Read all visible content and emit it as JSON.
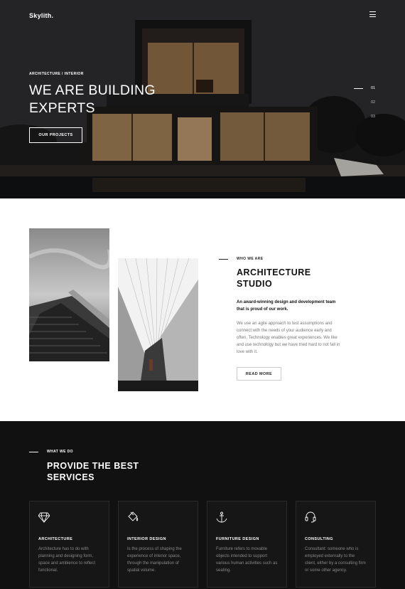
{
  "brand": {
    "logo": "Skylith."
  },
  "hero": {
    "kicker": "ARCHITECTURE / INTERIOR",
    "title": "WE ARE BUILDING EXPERTS",
    "cta": "OUR PROJECTS",
    "slides": [
      "01",
      "02",
      "03"
    ],
    "active_slide": "01"
  },
  "about": {
    "kicker": "WHO WE ARE",
    "title": "ARCHITECTURE STUDIO",
    "lead": "An award-winning design and development team that is proud of our work.",
    "body": "We use an agile approach to test assumptions and connect with the needs of your audience early and often. Technology enables great experiences. We like and use technology but we have tried hard to not fall in love with it.",
    "cta": "READ MORE"
  },
  "services": {
    "kicker": "WHAT WE DO",
    "title": "PROVIDE THE BEST SERVICES",
    "cards": [
      {
        "icon": "diamond-icon",
        "title": "ARCHITECTURE",
        "text": "Architecture has to do with planning and designing form, space and ambience to reflect functional."
      },
      {
        "icon": "paint-bucket-icon",
        "title": "INTERIOR DESIGN",
        "text": "Is the process of shaping the experience of interior space, through the manipulation of spatial volume."
      },
      {
        "icon": "anchor-icon",
        "title": "FURNITURE DESIGN",
        "text": "Furniture refers to movable objects intended to support various human activities such as seating."
      },
      {
        "icon": "headset-icon",
        "title": "CONSULTING",
        "text": "Consultant: someone who is employed externally to the client, either by a consulting firm or some other agency."
      }
    ]
  },
  "colors": {
    "hero_bg": "#2b2b2d",
    "dark_section": "#111111",
    "text": "#222222",
    "muted": "#777777"
  }
}
